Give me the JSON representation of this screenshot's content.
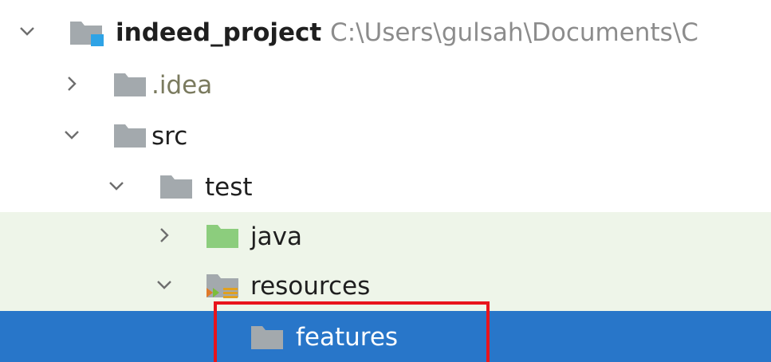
{
  "colors": {
    "folder_gray": "#a3a9ad",
    "folder_green": "#8ccd7d",
    "root_badge": "#2ea3e6",
    "selection": "#2876c9",
    "test_tint": "#eef5e9",
    "highlight_border": "#e8141c"
  },
  "tree": {
    "root": {
      "name": "indeed_project",
      "path": "C:\\Users\\gulsah\\Documents\\C",
      "icon": "module-folder-icon",
      "expanded": true
    },
    "idea": {
      "name": ".idea",
      "icon": "folder-icon",
      "expanded": false
    },
    "src": {
      "name": "src",
      "icon": "folder-icon",
      "expanded": true
    },
    "test": {
      "name": "test",
      "icon": "folder-icon",
      "expanded": true
    },
    "java": {
      "name": "java",
      "icon": "test-sources-folder-icon",
      "expanded": false
    },
    "resources": {
      "name": "resources",
      "icon": "test-resources-folder-icon",
      "expanded": true
    },
    "features": {
      "name": "features",
      "icon": "folder-icon",
      "selected": true
    }
  }
}
